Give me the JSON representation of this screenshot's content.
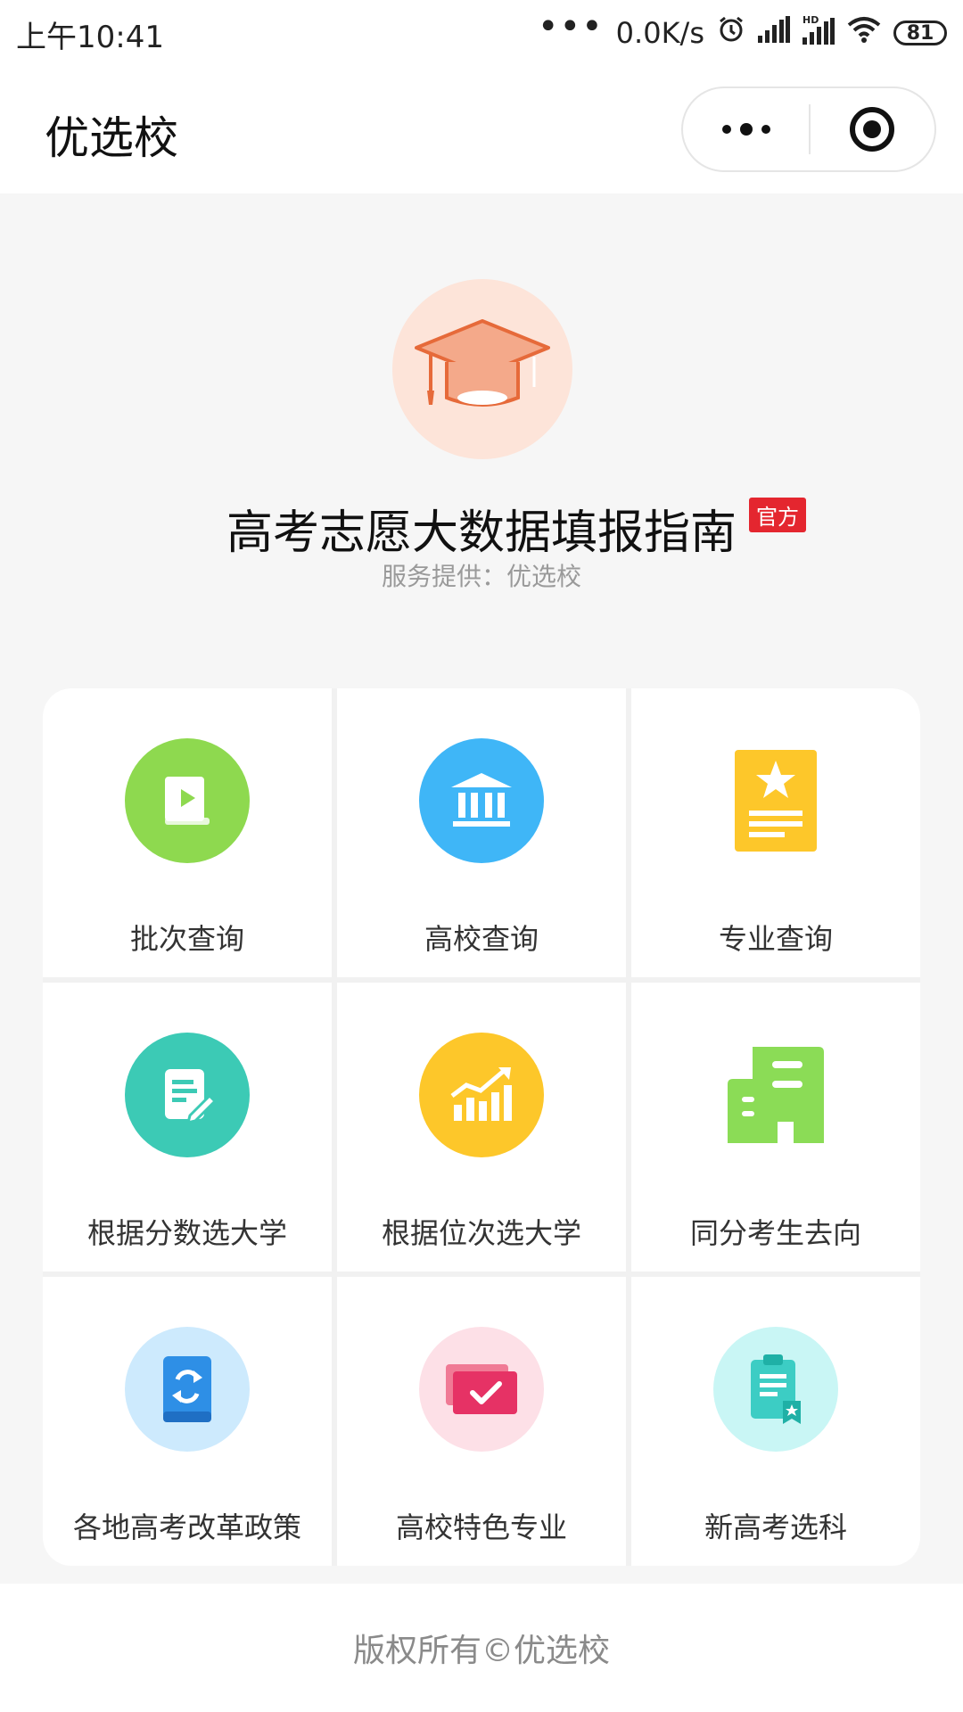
{
  "status_bar": {
    "time": "上午10:41",
    "network_speed": "0.0K/s",
    "battery": "81"
  },
  "nav": {
    "title": "优选校"
  },
  "hero": {
    "title": "高考志愿大数据填报指南",
    "badge": "官方",
    "subtitle": "服务提供：优选校"
  },
  "grid": {
    "items": [
      {
        "label": "批次查询",
        "icon": "book-play-icon",
        "color": "#8ed94f"
      },
      {
        "label": "高校查询",
        "icon": "university-building-icon",
        "color": "#3fb6f7"
      },
      {
        "label": "专业查询",
        "icon": "star-document-icon",
        "color": "#fdc72a"
      },
      {
        "label": "根据分数选大学",
        "icon": "edit-document-icon",
        "color": "#3ccab5"
      },
      {
        "label": "根据位次选大学",
        "icon": "trend-chart-icon",
        "color": "#fdc72a"
      },
      {
        "label": "同分考生去向",
        "icon": "building-icon",
        "color": "#8bdc56"
      },
      {
        "label": "各地高考改革政策",
        "icon": "refresh-book-icon",
        "color": "#cdeafd"
      },
      {
        "label": "高校特色专业",
        "icon": "checkmark-card-icon",
        "color": "#fde0e7"
      },
      {
        "label": "新高考选科",
        "icon": "clipboard-star-icon",
        "color": "#c9f6f5"
      }
    ]
  },
  "footer": {
    "text": "版权所有©优选校"
  }
}
